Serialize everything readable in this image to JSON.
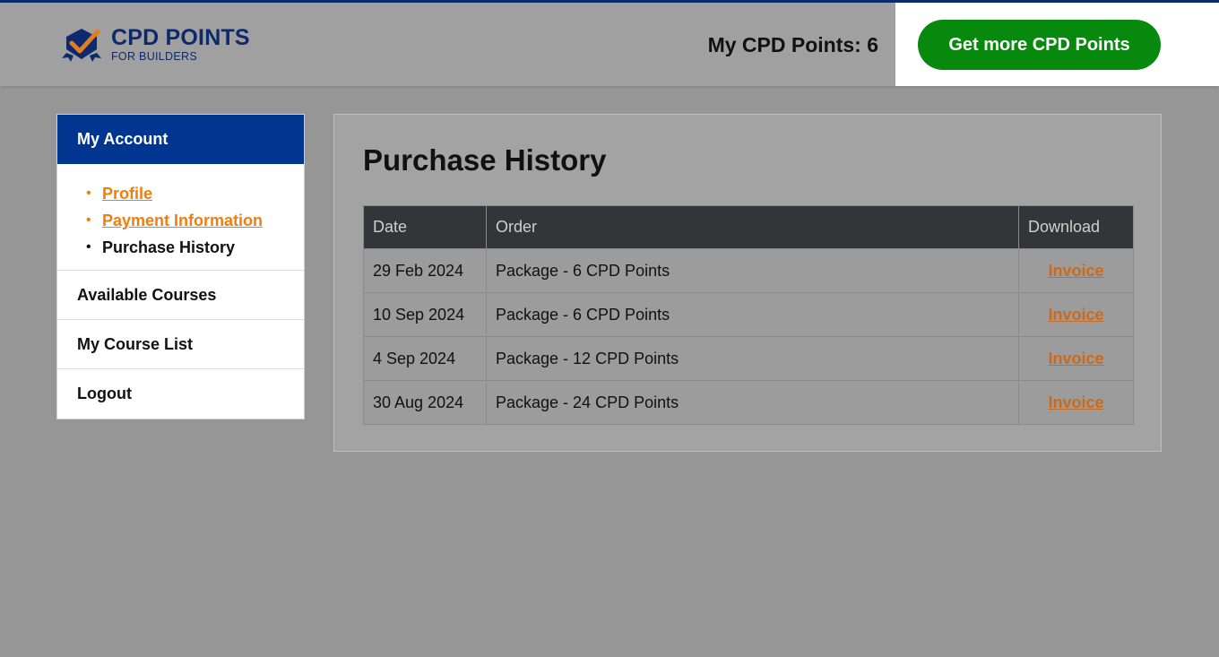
{
  "header": {
    "logo_title": "CPD POINTS",
    "logo_subtitle": "FOR BUILDERS",
    "points_label": "My CPD Points: 6",
    "cta_label": "Get more CPD Points"
  },
  "sidebar": {
    "heading": "My Account",
    "submenu": [
      {
        "label": "Profile",
        "link": true
      },
      {
        "label": "Payment Information",
        "link": true
      },
      {
        "label": "Purchase History",
        "link": false
      }
    ],
    "items": [
      {
        "label": "Available Courses"
      },
      {
        "label": "My Course List"
      },
      {
        "label": "Logout"
      }
    ]
  },
  "main": {
    "title": "Purchase History",
    "table": {
      "headers": [
        "Date",
        "Order",
        "Download"
      ],
      "rows": [
        {
          "date": "29 Feb 2024",
          "order": "Package - 6 CPD Points",
          "download": "Invoice"
        },
        {
          "date": "10 Sep 2024",
          "order": "Package - 6 CPD Points",
          "download": "Invoice"
        },
        {
          "date": "4 Sep 2024",
          "order": "Package - 12 CPD Points",
          "download": "Invoice"
        },
        {
          "date": "30 Aug 2024",
          "order": "Package - 24 CPD Points",
          "download": "Invoice"
        }
      ]
    }
  },
  "colors": {
    "brand_navy": "#0d2a6e",
    "sidebar_heading_bg": "#003690",
    "cta_green": "#07890d",
    "link_orange": "#f07d10"
  },
  "icons": {
    "logo": "checkmark-badge-icon"
  }
}
